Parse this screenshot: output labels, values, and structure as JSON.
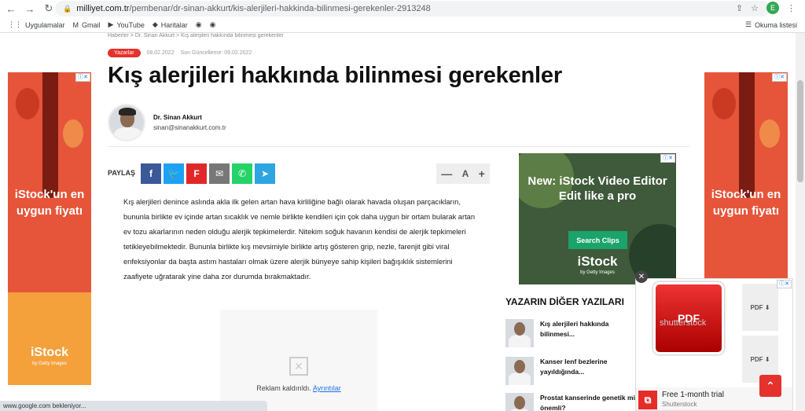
{
  "browser": {
    "url_host": "milliyet.com.tr",
    "url_path": "/pembenar/dr-sinan-akkurt/kis-alerjileri-hakkinda-bilinmesi-gerekenler-2913248",
    "avatar_letter": "E",
    "bookmarks": [
      {
        "label": "Uygulamalar",
        "icon": "apps-grid-icon",
        "glyph": "⋮⋮"
      },
      {
        "label": "Gmail",
        "icon": "gmail-icon",
        "glyph": "M"
      },
      {
        "label": "YouTube",
        "icon": "youtube-icon",
        "glyph": "▶"
      },
      {
        "label": "Haritalar",
        "icon": "maps-pin-icon",
        "glyph": "◆"
      },
      {
        "label": "",
        "icon": "globe-icon",
        "glyph": "◉"
      },
      {
        "label": "",
        "icon": "globe-icon",
        "glyph": "◉"
      }
    ],
    "reading_list": "Okuma listesi",
    "status": "www.google.com bekleniyor..."
  },
  "article": {
    "breadcrumb": "Haberler  >  Dr. Sinan Akkurt  >  Kış alerjileri hakkında bilinmesi gerekenler",
    "tag": "Yazarlar",
    "date": "08.02.2022",
    "updated": "Son Güncelleme:  09.02.2022",
    "title": "Kış alerjileri hakkında bilinmesi gerekenler",
    "author_name": "Dr. Sinan Akkurt",
    "author_email": "sinan@sinanakkurt.com.tr",
    "share_label": "PAYLAŞ",
    "share_buttons": [
      {
        "name": "facebook",
        "glyph": "f",
        "color": "#3b5998"
      },
      {
        "name": "twitter",
        "glyph": "🐦",
        "color": "#1da1f2"
      },
      {
        "name": "flipboard",
        "glyph": "F",
        "color": "#e12828"
      },
      {
        "name": "email",
        "glyph": "✉",
        "color": "#777777"
      },
      {
        "name": "whatsapp",
        "glyph": "✆",
        "color": "#25d366"
      },
      {
        "name": "telegram",
        "glyph": "➤",
        "color": "#2ca5e0"
      }
    ],
    "font_controls": {
      "minus": "—",
      "a": "A",
      "plus": "+"
    },
    "body": "Kış alerjileri denince aslında akla ilk gelen artan hava kirliliğine bağlı olarak havada oluşan parçacıkların, bununla birlikte ev içinde artan sıcaklık ve nemle birlikte kendileri için çok daha uygun bir ortam bularak artan ev tozu akarlarının neden olduğu alerjik tepkimelerdir. Nitekim soğuk havanın kendisi de alerjik tepkimeleri tetikleyebilmektedir. Bununla birlikte kış mevsimiyle birlikte artış gösteren grip, nezle, farenjit gibi viral enfeksiyonlar da başta astım hastaları olmak üzere alerjik bünyeye sahip kişileri bağışıklık sistemlerini zaafiyete uğratarak yine daha zor durumda bırakmaktadır.",
    "ad_removed": "Reklam kaldırıldı.",
    "ad_removed_link": "Ayrıntılar"
  },
  "side_ads": {
    "headline": "iStock'un en uygun fiyatı",
    "brand": "iStock",
    "brand_sub": "by Getty Images"
  },
  "center_ad": {
    "headline": "New: iStock Video Editor Edit like a pro",
    "cta": "Search Clips",
    "brand": "iStock",
    "brand_sub": "by Getty Images"
  },
  "other_posts": {
    "title": "YAZARIN DİĞER YAZILARI",
    "items": [
      "Kış alerjileri hakkında bilinmesi...",
      "Kanser lenf bezlerine yayıldığında...",
      "Prostat kanserinde genetik mi önemli?"
    ]
  },
  "popup_ad": {
    "pdf": "PDF",
    "watermark": "shutterstock",
    "title": "Free 1-month trial",
    "subtitle": "Shutterstock"
  }
}
